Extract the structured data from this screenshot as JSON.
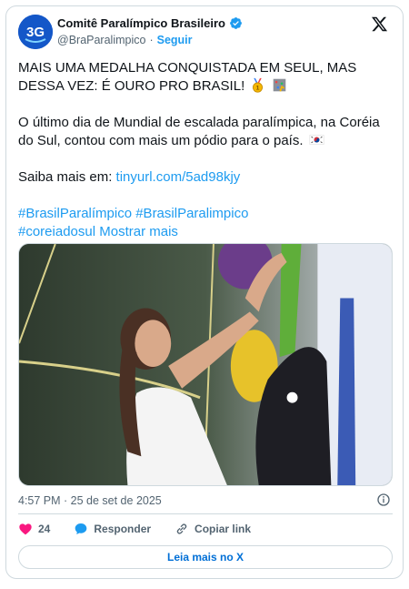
{
  "author": {
    "name": "Comitê Paralímpico Brasileiro",
    "handle": "@BraParalimpico",
    "separator": "·",
    "follow_label": "Seguir",
    "avatar_text": "3G"
  },
  "tweet": {
    "line1": "MAIS UMA MEDALHA CONQUISTADA EM SEUL, MAS DESSA VEZ: É OURO PRO BRASIL!",
    "line2": "O último dia de Mundial de escalada paralímpica, na Coréia do Sul, contou com mais um pódio para o país.",
    "saiba_prefix": "Saiba mais em: ",
    "link": "tinyurl.com/5ad98kjy",
    "hashtag1": "#BrasilParalímpico",
    "hashtag2": "#BrasilParalimpico",
    "hashtag3": "#coreiadosul",
    "show_more": "Mostrar mais"
  },
  "timestamp": "4:57 PM · 25 de set de 2025",
  "actions": {
    "like_count": "24",
    "reply_label": "Responder",
    "copy_label": "Copiar link"
  },
  "read_more": "Leia mais no X",
  "colors": {
    "accent": "#1d9bf0",
    "like": "#f91880",
    "text": "#0f1419",
    "muted": "#536471",
    "border": "#cfd9de"
  },
  "icons": [
    "verified-badge-icon",
    "x-logo-icon",
    "gold-medal-icon",
    "climbing-wall-icon",
    "korea-flag-icon",
    "info-icon",
    "heart-icon",
    "reply-icon",
    "link-icon"
  ]
}
